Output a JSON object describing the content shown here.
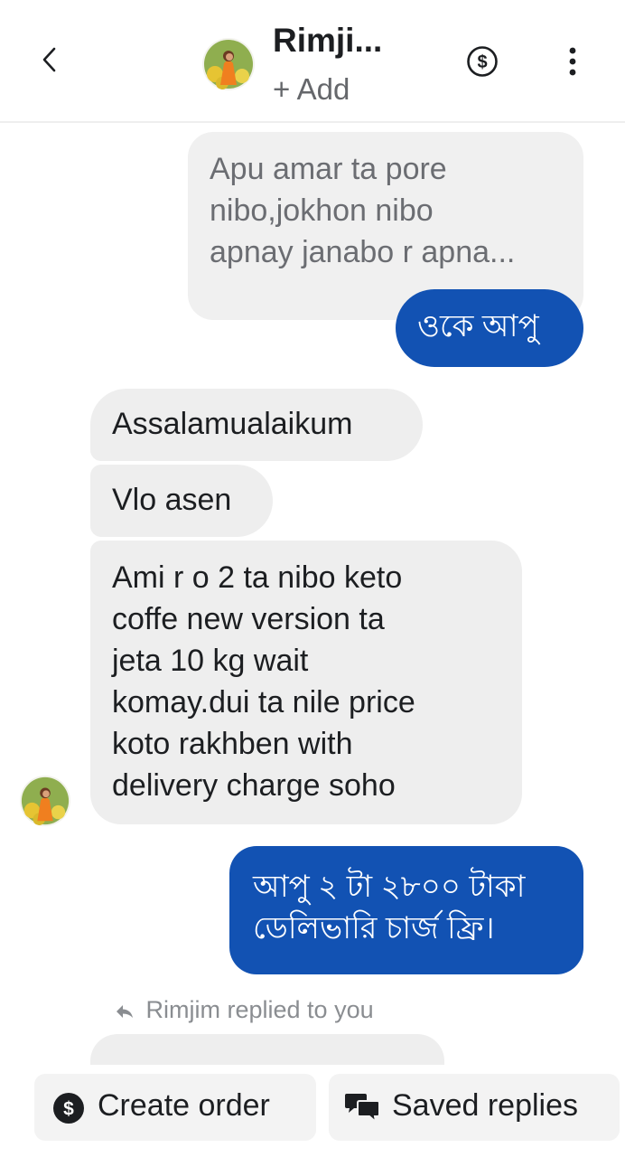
{
  "header": {
    "back_icon": "chevron-left-icon",
    "contact_name": "Rimji...",
    "add_label": "+ Add",
    "actions": [
      "dollar-circle-icon",
      "more-vertical-icon"
    ]
  },
  "messages": [
    {
      "direction": "outgoing-quoted",
      "lines": [
        "Apu amar ta pore",
        "nibo,jokhon nibo",
        "apnay janabo r apna..."
      ]
    },
    {
      "direction": "outgoing",
      "lines": [
        "ওকে আপু"
      ]
    },
    {
      "direction": "incoming",
      "lines": [
        "Assalamualaikum"
      ]
    },
    {
      "direction": "incoming",
      "lines": [
        "Vlo asen"
      ]
    },
    {
      "direction": "incoming",
      "lines": [
        "Ami r o 2 ta nibo keto",
        "coffe new version ta",
        "jeta 10 kg wait",
        "komay.dui ta nile price",
        "koto rakhben with",
        "delivery charge soho"
      ]
    },
    {
      "direction": "outgoing",
      "lines": [
        "আপু ২ টা ২৮০০ টাকা",
        "ডেলিভারি চার্জ ফ্রি।"
      ]
    }
  ],
  "reply_note": "Rimjim replied to you",
  "bottom_actions": {
    "create_order": "Create order",
    "saved_replies": "Saved replies"
  },
  "colors": {
    "outgoing_bubble": "#1252b3",
    "incoming_bubble": "#eeeeee",
    "muted_text": "#65676b"
  }
}
